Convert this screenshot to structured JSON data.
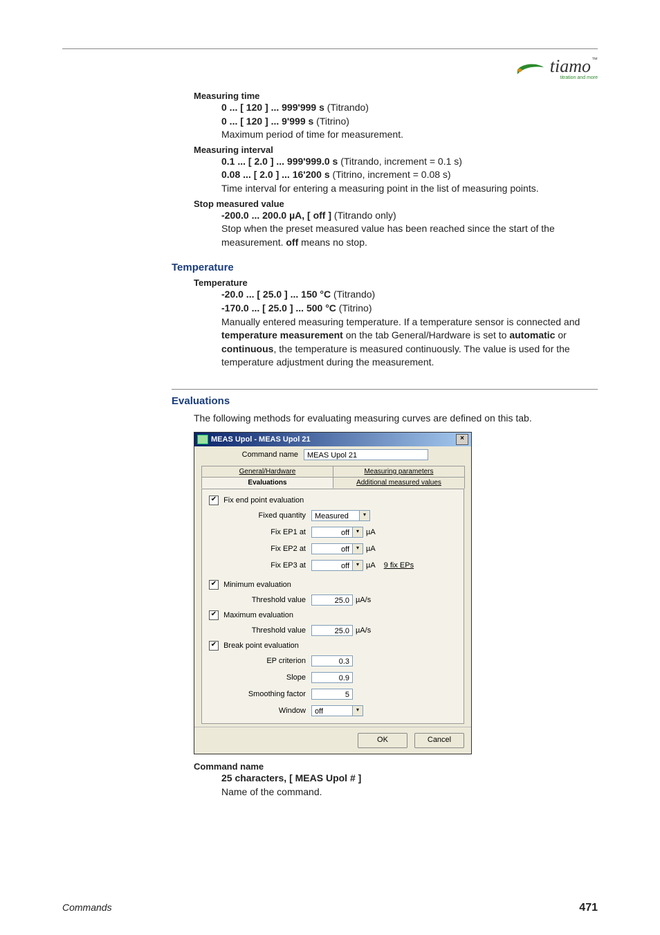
{
  "brand": {
    "name": "tiamo",
    "tm": "™",
    "tagline": "titration and more"
  },
  "measuring_time": {
    "title": "Measuring time",
    "r1_bold": "0 ... [ 120 ] ... 999'999 s",
    "r1_rest": " (Titrando)",
    "r2_bold": "0 ... [ 120 ] ... 9'999 s",
    "r2_rest": " (Titrino)",
    "desc": "Maximum period of time for measurement."
  },
  "measuring_interval": {
    "title": "Measuring interval",
    "r1_bold": "0.1 ... [ 2.0 ] ... 999'999.0 s",
    "r1_rest": " (Titrando, increment = 0.1 s)",
    "r2_bold": "0.08 ... [ 2.0 ] ... 16'200 s",
    "r2_rest": " (Titrino, increment = 0.08 s)",
    "desc": "Time interval for entering a measuring point in the list of measuring points."
  },
  "stop_value": {
    "title": "Stop measured value",
    "r1_bold": "-200.0 ... 200.0 µA, [ off ]",
    "r1_rest": " (Titrando only)",
    "desc_a": "Stop when the preset measured value has been reached since the start of the measurement. ",
    "off": "off",
    "desc_b": " means no stop."
  },
  "temperature": {
    "heading": "Temperature",
    "title": "Temperature",
    "r1_bold": "-20.0 ... [ 25.0 ] ... 150 °C",
    "r1_rest": " (Titrando)",
    "r2_bold": "-170.0 ... [ 25.0 ] ... 500 °C",
    "r2_rest": " (Titrino)",
    "d1": "Manually entered measuring temperature. If a temperature sensor is connected and ",
    "b1": "temperature measurement",
    "d2": " on the tab General/Hardware is set to ",
    "b2": "automatic",
    "d3": " or ",
    "b3": "continuous",
    "d4": ", the temperature is measured continuously. The value is used for the temperature adjustment during the measurement."
  },
  "evaluations": {
    "heading": "Evaluations",
    "intro": "The following methods for evaluating measuring curves are defined on this tab."
  },
  "dlg": {
    "title": "MEAS Upol - MEAS Upol 21",
    "lbl_cmd": "Command name",
    "cmd_value": "MEAS Upol 21",
    "tab_gh": "General/Hardware",
    "tab_mp": "Measuring parameters",
    "tab_ev": "Evaluations",
    "tab_amv": "Additional measured values",
    "chk_fix": "Fix end point evaluation",
    "lbl_fixed_q": "Fixed quantity",
    "val_fixed_q": "Measured ...",
    "lbl_ep1": "Fix EP1 at",
    "lbl_ep2": "Fix EP2 at",
    "lbl_ep3": "Fix EP3 at",
    "val_off": "off",
    "unit_ua": "µA",
    "nine_fix": "9 fix EPs",
    "chk_min": "Minimum evaluation",
    "lbl_thr": "Threshold value",
    "val_thr": "25.0",
    "unit_uas": "µA/s",
    "chk_max": "Maximum evaluation",
    "chk_bp": "Break point evaluation",
    "lbl_epc": "EP criterion",
    "val_epc": "0.3",
    "lbl_slope": "Slope",
    "val_slope": "0.9",
    "lbl_smooth": "Smoothing factor",
    "val_smooth": "5",
    "lbl_window": "Window",
    "val_window": "off",
    "btn_ok": "OK",
    "btn_cancel": "Cancel"
  },
  "command_name": {
    "title": "Command name",
    "bold": "25 characters, [ MEAS Upol # ]",
    "desc": "Name of the command."
  },
  "footer": {
    "left": "Commands",
    "right": "471"
  }
}
